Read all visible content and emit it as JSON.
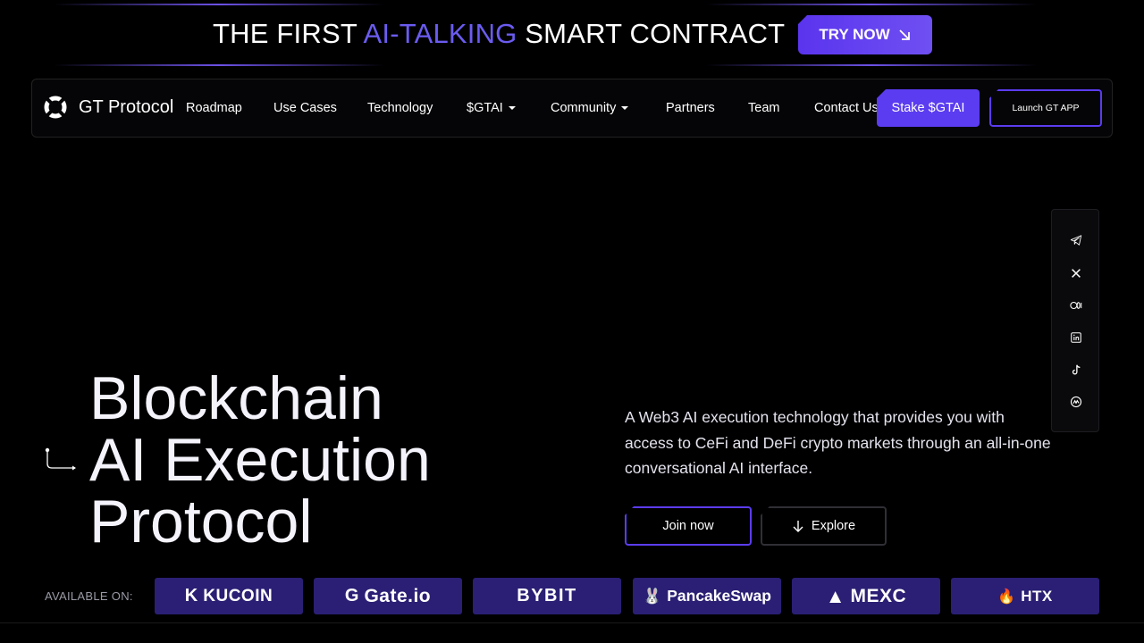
{
  "banner": {
    "title_prefix": "THE FIRST ",
    "title_accent": "AI-TALKING",
    "title_suffix": " SMART CONTRACT",
    "cta_label": "TRY NOW"
  },
  "nav": {
    "logo_text": "GT Protocol",
    "items": [
      {
        "label": "Roadmap"
      },
      {
        "label": "Use Cases"
      },
      {
        "label": "Technology"
      },
      {
        "label": "$GTAI"
      },
      {
        "label": "Community"
      },
      {
        "label": "Partners"
      },
      {
        "label": "Team"
      },
      {
        "label": "Contact Us"
      }
    ],
    "stake_label": "Stake $GTAI",
    "launch_label": "Launch GT APP"
  },
  "social": {
    "icons": [
      "telegram-icon",
      "x-icon",
      "medium-icon",
      "linkedin-icon",
      "tiktok-icon",
      "coinmarketcap-icon"
    ]
  },
  "hero": {
    "title_line1": "Blockchain",
    "title_line2": "AI Execution",
    "title_line3": "Protocol",
    "description": "A Web3 AI execution technology that provides you with access to CeFi and DeFi crypto markets through an all-in-one conversational AI interface.",
    "join_label": "Join now",
    "explore_label": "Explore"
  },
  "exchanges": {
    "label": "AVAILABLE ON:",
    "items": [
      {
        "name": "KUCOIN",
        "glyph": "K"
      },
      {
        "name": "Gate.io",
        "glyph": "G"
      },
      {
        "name": "BYBIT",
        "glyph": ""
      },
      {
        "name": "PancakeSwap",
        "glyph": "🐰"
      },
      {
        "name": "MEXC",
        "glyph": "▲"
      },
      {
        "name": "HTX",
        "glyph": "🔥"
      }
    ]
  },
  "colors": {
    "accent": "#5b3cf0",
    "accent_text": "#6b5cf0",
    "exchange_bg": "#2a1f74",
    "background": "#000000"
  }
}
